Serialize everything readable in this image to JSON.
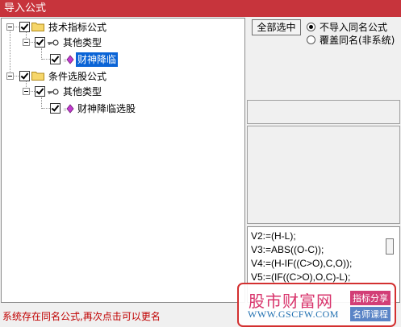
{
  "window": {
    "title": "导入公式"
  },
  "tree": {
    "groups": [
      {
        "label": "技术指标公式",
        "type": {
          "label": "其他类型",
          "item": "财神降临"
        }
      },
      {
        "label": "条件选股公式",
        "type": {
          "label": "其他类型",
          "item": "财神降临选股"
        }
      }
    ]
  },
  "options": {
    "select_all": "全部选中",
    "no_import_same_name": "不导入同名公式",
    "overwrite_same_name": "覆盖同名(非系统)"
  },
  "code": {
    "lines": [
      "V2:=(H-L);",
      "V3:=ABS((O-C));",
      "V4:=(H-IF((C>O),C,O));",
      "V5:=(IF((C>O),O,C)-L);"
    ]
  },
  "status": {
    "message": "系统存在同名公式,再次点击可以更名"
  },
  "watermark": {
    "site": "股市财富网",
    "url": "WWW.GSCFW.COM",
    "tag1": "指标分享",
    "tag2": "名师课程"
  },
  "colors": {
    "title_bar": "#c7343c",
    "selection": "#0a64d6",
    "status_text": "#c00000"
  }
}
